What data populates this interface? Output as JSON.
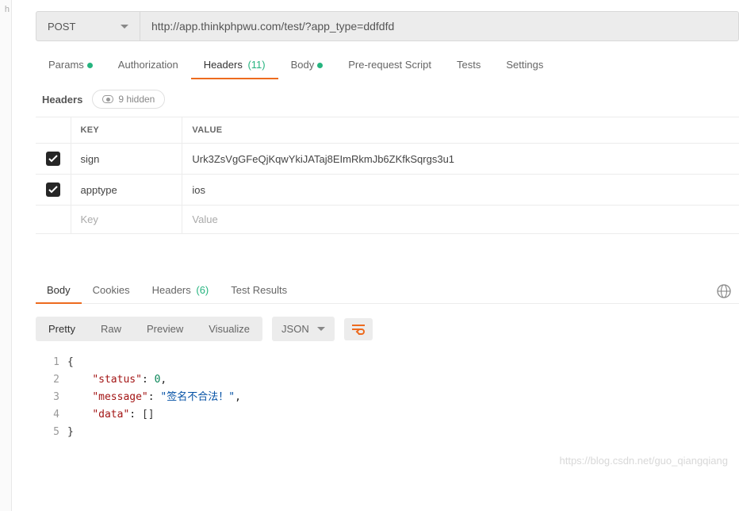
{
  "left_gutter_text": "h",
  "request": {
    "method": "POST",
    "url": "http://app.thinkphpwu.com/test/?app_type=ddfdfd"
  },
  "tabs": {
    "params": "Params",
    "authorization": "Authorization",
    "headers": "Headers",
    "headers_count": "(11)",
    "body": "Body",
    "prerequest": "Pre-request Script",
    "tests": "Tests",
    "settings": "Settings"
  },
  "headers_section": {
    "title": "Headers",
    "hidden_label": "9 hidden"
  },
  "table": {
    "col_key": "KEY",
    "col_value": "VALUE",
    "rows": [
      {
        "checked": true,
        "key": "sign",
        "value": "Urk3ZsVgGFeQjKqwYkiJATaj8EImRkmJb6ZKfkSqrgs3u1"
      },
      {
        "checked": true,
        "key": "apptype",
        "value": "ios"
      }
    ],
    "placeholder_key": "Key",
    "placeholder_value": "Value"
  },
  "response_tabs": {
    "body": "Body",
    "cookies": "Cookies",
    "headers": "Headers",
    "headers_count": "(6)",
    "test_results": "Test Results"
  },
  "response_toolbar": {
    "pretty": "Pretty",
    "raw": "Raw",
    "preview": "Preview",
    "visualize": "Visualize",
    "format": "JSON"
  },
  "response_body": {
    "lines": [
      "1",
      "2",
      "3",
      "4",
      "5"
    ],
    "json": {
      "status_key": "\"status\"",
      "status_val": "0",
      "message_key": "\"message\"",
      "message_val": "\"签名不合法！\"",
      "data_key": "\"data\"",
      "data_val": "[]"
    }
  },
  "watermark": "https://blog.csdn.net/guo_qiangqiang"
}
